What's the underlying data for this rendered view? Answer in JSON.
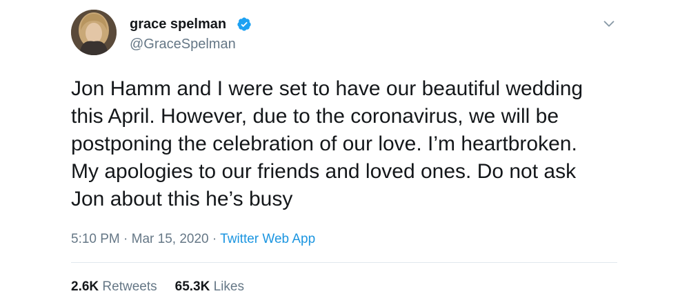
{
  "author": {
    "display_name": "grace spelman",
    "handle": "@GraceSpelman",
    "verified_icon": "verified-badge-icon",
    "avatar_icon": "profile-photo"
  },
  "tweet": {
    "text": "Jon Hamm and I were set to have our beautiful wedding\nthis April. However, due to the coronavirus, we will be\npostponing the celebration of our love. I’m heartbroken.\nMy apologies to our friends and loved ones. Do not ask\nJon about this he’s busy",
    "time": "5:10 PM",
    "separator": " · ",
    "date": "Mar 15, 2020",
    "source": "Twitter Web App"
  },
  "stats": {
    "retweets_count": "2.6K",
    "retweets_label": "Retweets",
    "likes_count": "65.3K",
    "likes_label": "Likes"
  },
  "menu": {
    "icon": "chevron-down-icon"
  },
  "colors": {
    "text": "#14171a",
    "secondary": "#657786",
    "link": "#1b95e0",
    "verified": "#1da1f2",
    "divider": "#e1e8ed"
  }
}
